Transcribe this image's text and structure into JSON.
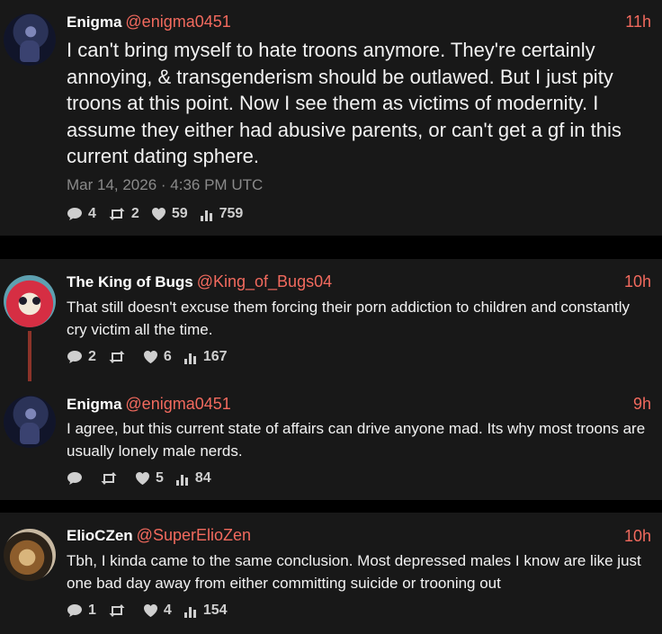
{
  "posts": [
    {
      "author": "Enigma",
      "handle": "@enigma0451",
      "time": "11h",
      "text": "I can't bring myself to hate troons anymore. They're certainly annoying, & transgenderism should be outlawed. But I just pity troons at this point. Now I see them as victims of modernity. I assume they either had abusive parents, or can't get a gf in this current dating sphere.",
      "date": "Mar 14, 2026 · 4:36 PM UTC",
      "replies": "4",
      "reposts": "2",
      "likes": "59",
      "views": "759"
    },
    {
      "author": "The King of Bugs",
      "handle": "@King_of_Bugs04",
      "time": "10h",
      "text": "That still doesn't excuse them forcing their porn addiction to children and constantly cry victim all the time.",
      "replies": "2",
      "reposts": "",
      "likes": "6",
      "views": "167"
    },
    {
      "author": "Enigma",
      "handle": "@enigma0451",
      "time": "9h",
      "text": "I agree, but this current state of affairs can drive anyone mad. Its why most troons are usually lonely male nerds.",
      "replies": "",
      "reposts": "",
      "likes": "5",
      "views": "84"
    },
    {
      "author": "ElioCZen",
      "handle": "@SuperElioZen",
      "time": "10h",
      "text": "Tbh, I kinda came to the same conclusion. Most depressed males I know are like just one bad day away from either committing suicide or trooning out",
      "replies": "1",
      "reposts": "",
      "likes": "4",
      "views": "154"
    }
  ],
  "colors": {
    "accent": "#f26a5e",
    "card": "#181818",
    "background": "#000000",
    "thread": "#8c3329"
  },
  "icons": [
    "reply-icon",
    "repost-icon",
    "like-icon",
    "views-icon"
  ]
}
